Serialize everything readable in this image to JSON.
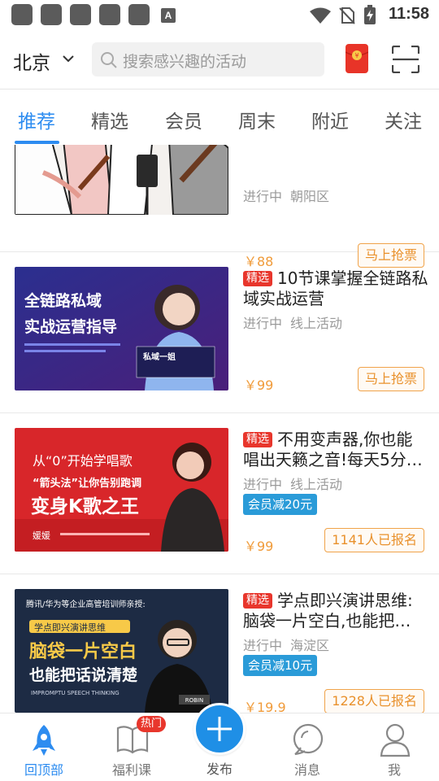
{
  "status_bar": {
    "time": "11:58",
    "notification_icon_letter": "A"
  },
  "header": {
    "city": "北京",
    "search_placeholder": "搜索感兴趣的活动",
    "accent_color": "#2d8cf0"
  },
  "tabs": [
    "推荐",
    "精选",
    "会员",
    "周末",
    "附近",
    "关注"
  ],
  "active_tab": "推荐",
  "activities": [
    {
      "title": "",
      "status": "进行中",
      "location": "朝阳区",
      "price": "￥88",
      "action": "马上抢票"
    },
    {
      "tag": "精选",
      "title": "10节课掌握全链路私域实战运营",
      "status": "进行中",
      "location": "线上活动",
      "price": "￥99",
      "action": "马上抢票",
      "poster_text": [
        "全链路私域",
        "实战运营指导",
        "私域一姐"
      ]
    },
    {
      "tag": "精选",
      "title": "不用变声器,你也能唱出天籁之音!每天5分…",
      "status": "进行中",
      "location": "线上活动",
      "member_discount": "会员减20元",
      "price": "￥99",
      "action": "1141人已报名",
      "poster_text": [
        "从“0”开始学唱歌",
        "“箭头法”让你告别跑调",
        "变身K歌之王",
        "媛媛"
      ]
    },
    {
      "tag": "精选",
      "title": "学点即兴演讲思维:脑袋一片空白,也能把…",
      "status": "进行中",
      "location": "海淀区",
      "member_discount": "会员减10元",
      "price": "￥19.9",
      "action": "1228人已报名",
      "poster_text": [
        "腾讯/华为等企业高管培训师亲授:",
        "学点即兴演讲思维",
        "脑袋一片空白",
        "也能把话说清楚",
        "IMPROMPTU SPEECH THINKING",
        "ROBIN"
      ]
    }
  ],
  "bottom_nav": [
    {
      "label": "回顶部",
      "icon": "rocket-icon",
      "active": true
    },
    {
      "label": "福利课",
      "icon": "book-icon",
      "badge": "热门"
    },
    {
      "label": "发布",
      "icon": "plus-icon"
    },
    {
      "label": "消息",
      "icon": "chat-bubble-icon"
    },
    {
      "label": "我",
      "icon": "person-icon"
    }
  ]
}
